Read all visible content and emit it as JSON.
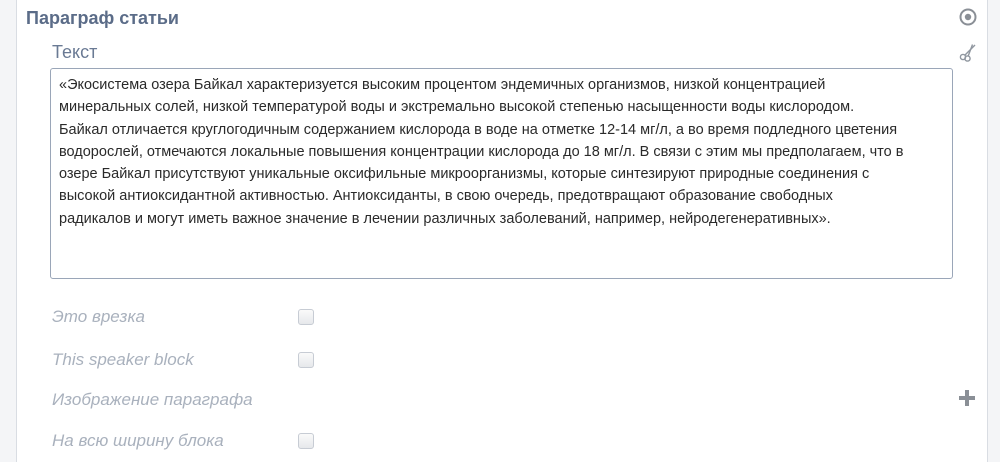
{
  "header": {
    "title": "Параграф статьи",
    "right_icon": "target-icon"
  },
  "text_field": {
    "label": "Текст",
    "action_icon": "scissors-icon",
    "value": "«Экосистема озера Байкал характеризуется высоким процентом эндемичных организмов, низкой концентрацией\nминеральных солей, низкой температурой воды и экстремально высокой степенью насыщенности воды кислородом.\nБайкал отличается круглогодичным содержанием кислорода в воде на отметке 12-14 мг/л, а во время подледного цветения\nводорослей, отмечаются локальные повышения концентрации кислорода до 18 мг/л. В связи с этим мы предполагаем, что в\nозере Байкал присутствуют уникальные оксифильные микроорганизмы, которые синтезируют природные соединения с\nвысокой антиоксидантной активностью. Антиоксиданты, в свою очередь, предотвращают образование свободных\nрадикалов и могут иметь важное значение в лечении различных заболеваний, например, нейродегенеративных»."
  },
  "options": {
    "insert_label": "Это врезка",
    "speaker_label": "This speaker block",
    "image_label": "Изображение параграфа",
    "image_add_icon": "plus-icon",
    "fullwidth_label": "На всю ширину блока"
  },
  "colors": {
    "header_text": "#5b6c88",
    "label_text": "#6a7a94",
    "option_text": "#a9b1bd",
    "textarea_border": "#9aa6b8",
    "icon_gray": "#8a8f96"
  }
}
